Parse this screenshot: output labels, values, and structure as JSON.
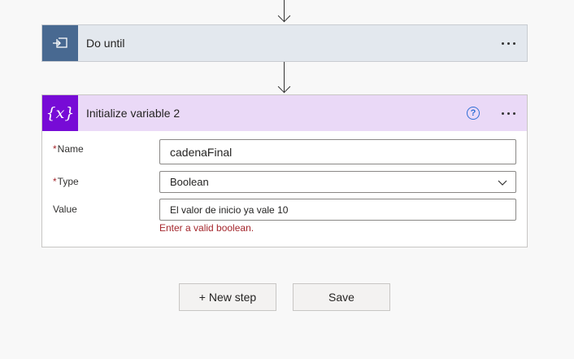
{
  "do_until": {
    "title": "Do until",
    "icon": "loop-icon",
    "header_color": "#e3e8ee",
    "icon_color": "#486991"
  },
  "init_var": {
    "title": "Initialize variable 2",
    "icon": "variable-icon",
    "icon_glyph": "{x}",
    "header_color": "#ead9f7",
    "icon_color": "#770bd6",
    "help_glyph": "?",
    "fields": {
      "name": {
        "label": "Name",
        "required": "*",
        "value": "cadenaFinal"
      },
      "type": {
        "label": "Type",
        "required": "*",
        "value": "Boolean"
      },
      "value": {
        "label": "Value",
        "value": "El valor de inicio ya vale 10",
        "error": "Enter a valid boolean."
      }
    }
  },
  "actions": {
    "new_step": "+ New step",
    "save": "Save"
  }
}
